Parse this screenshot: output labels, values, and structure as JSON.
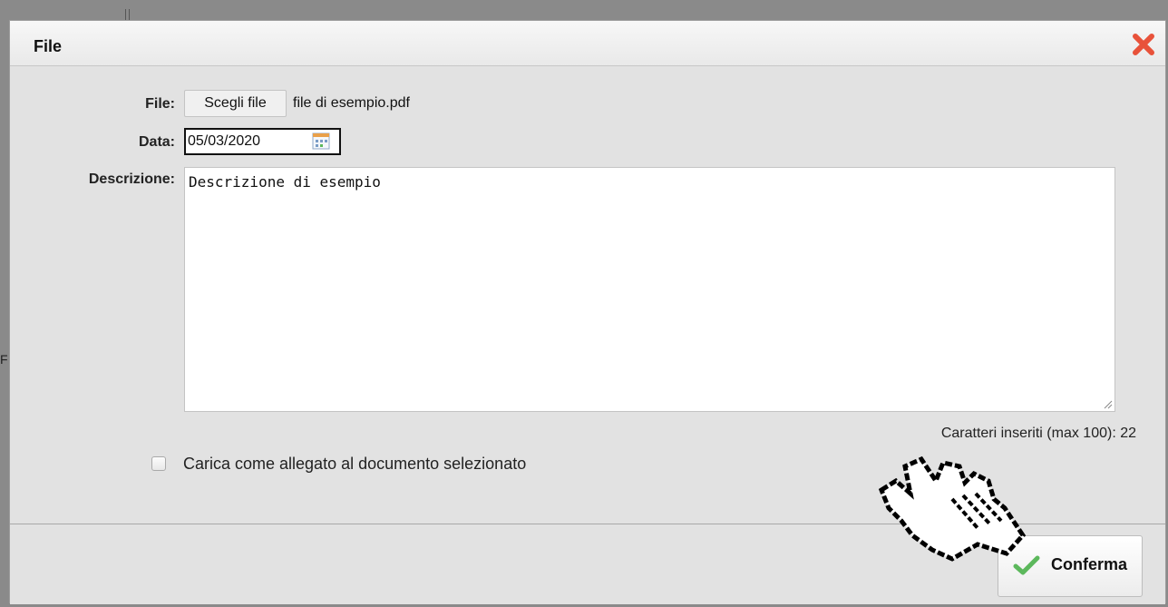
{
  "dialog": {
    "title": "File",
    "close_icon": "close-icon"
  },
  "form": {
    "file_label": "File:",
    "file_button": "Scegli file",
    "file_name": "file di esempio.pdf",
    "date_label": "Data:",
    "date_value": "05/03/2020",
    "calendar_icon": "calendar-icon",
    "description_label": "Descrizione:",
    "description_value": "Descrizione di esempio",
    "char_counter": "Caratteri inseriti (max 100): 22",
    "attach_checkbox_label": "Carica come allegato al documento selezionato",
    "attach_checked": false
  },
  "footer": {
    "confirm_label": "Conferma",
    "confirm_icon": "check-icon"
  },
  "background": {
    "edge_letter": "F"
  },
  "colors": {
    "close_red": "#e8523a",
    "check_green": "#5cb85c",
    "dialog_bg": "#e2e2e2"
  }
}
